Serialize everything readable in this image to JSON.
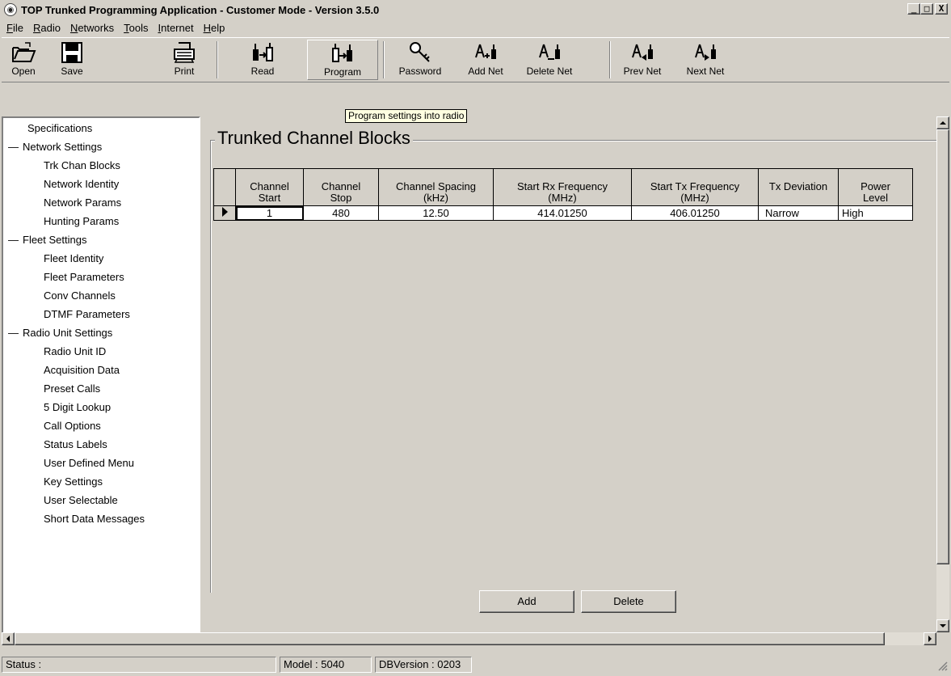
{
  "window": {
    "title": "TOP Trunked Programming Application - Customer Mode - Version 3.5.0",
    "app_icon": "radio-app-icon",
    "controls": {
      "minimize": "_",
      "maximize": "□",
      "close": "X"
    }
  },
  "menu": {
    "items": [
      {
        "u": "F",
        "rest": "ile"
      },
      {
        "u": "R",
        "rest": "adio"
      },
      {
        "u": "N",
        "rest": "etworks"
      },
      {
        "u": "T",
        "rest": "ools"
      },
      {
        "u": "I",
        "rest": "nternet"
      },
      {
        "u": "H",
        "rest": "elp"
      }
    ]
  },
  "toolbar": {
    "open": "Open",
    "save": "Save",
    "print": "Print",
    "read": "Read",
    "program": "Program",
    "password": "Password",
    "add_net": "Add Net",
    "delete_net": "Delete Net",
    "prev_net": "Prev Net",
    "next_net": "Next Net",
    "tooltip": "Program settings into radio"
  },
  "tree": {
    "items": [
      "Specifications",
      "Network Settings",
      "Trk Chan Blocks",
      "Network Identity",
      "Network Params",
      "Hunting Params",
      "Fleet Settings",
      "Fleet Identity",
      "Fleet Parameters",
      "Conv Channels",
      "DTMF Parameters",
      "Radio Unit Settings",
      "Radio Unit ID",
      "Acquisition Data",
      "Preset Calls",
      "5 Digit Lookup",
      "Call Options",
      "Status Labels",
      "User Defined Menu",
      "Key Settings",
      "User Selectable",
      "Short Data Messages"
    ],
    "collapse_marker": "—"
  },
  "main": {
    "title": "Trunked Channel Blocks",
    "table": {
      "headers": [
        [
          "Channel",
          "Start"
        ],
        [
          "Channel",
          "Stop"
        ],
        [
          "Channel Spacing",
          "(kHz)"
        ],
        [
          "Start Rx Frequency",
          "(MHz)"
        ],
        [
          "Start Tx Frequency",
          "(MHz)"
        ],
        [
          "Tx Deviation",
          ""
        ],
        [
          "Power",
          "Level"
        ]
      ],
      "rows": [
        [
          "1",
          "480",
          "12.50",
          "414.01250",
          "406.01250",
          "Narrow",
          "High"
        ]
      ]
    },
    "add_label": "Add",
    "delete_label": "Delete"
  },
  "status": {
    "status": "Status :",
    "model": "Model : 5040",
    "db": "DBVersion : 0203"
  }
}
